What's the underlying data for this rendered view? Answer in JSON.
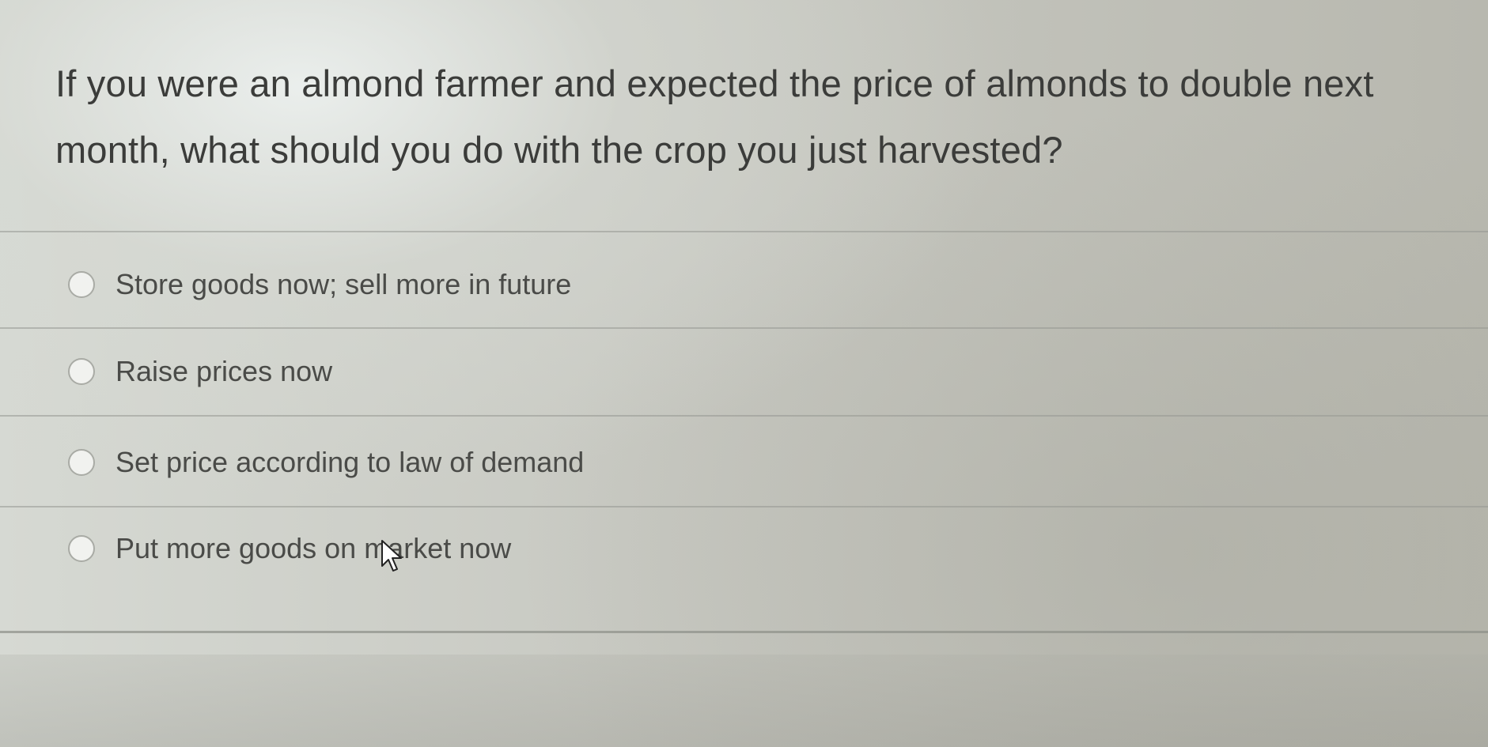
{
  "question": {
    "text": "If you were an almond farmer and expected the price of almonds to double next month, what should you do with the crop you just harvested?"
  },
  "options": [
    {
      "label": "Store goods now; sell more in future",
      "selected": false
    },
    {
      "label": "Raise prices now",
      "selected": false
    },
    {
      "label": "Set price according to law of demand",
      "selected": false
    },
    {
      "label": "Put more goods on market now",
      "selected": false
    }
  ],
  "cursor_icon": "arrow-pointer-icon"
}
